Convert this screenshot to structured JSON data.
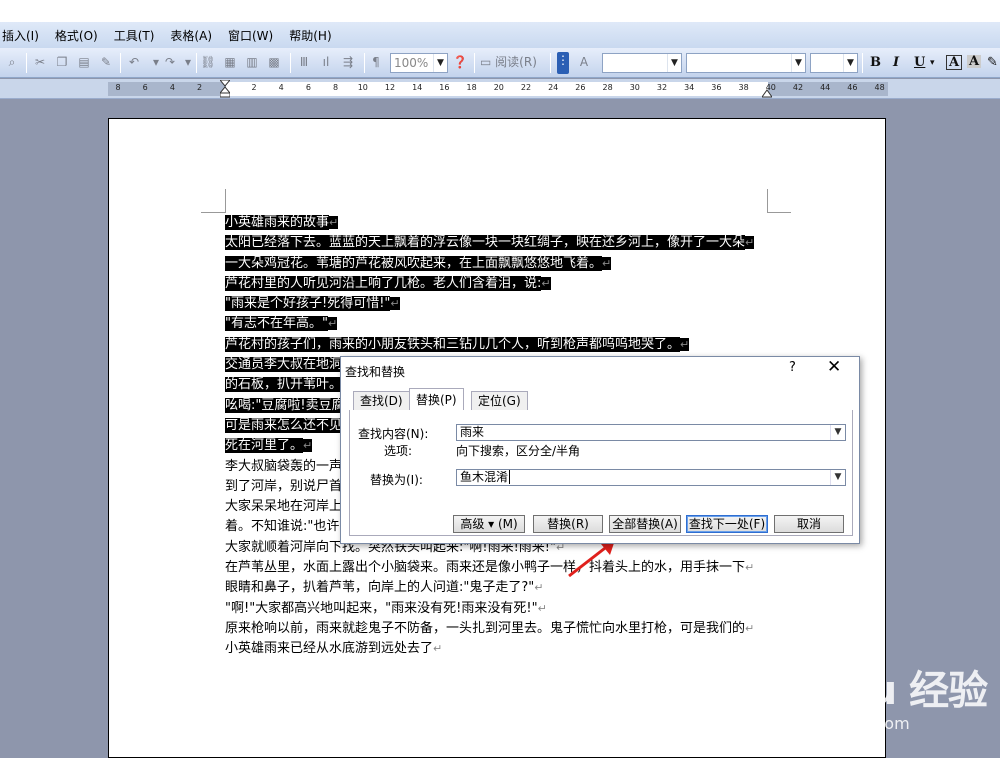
{
  "menu": [
    "插入(I)",
    "格式(O)",
    "工具(T)",
    "表格(A)",
    "窗口(W)",
    "帮助(H)"
  ],
  "toolbar": {
    "zoom_value": "100%",
    "read_label": "阅读(R)",
    "bold_label": "B",
    "italic_label": "I",
    "underline_label": "U",
    "fontcolor_label": "A",
    "highlight_label": "A"
  },
  "ruler_numbers": [
    "8",
    "6",
    "4",
    "2",
    "2",
    "4",
    "6",
    "8",
    "10",
    "12",
    "14",
    "16",
    "18",
    "20",
    "22",
    "24",
    "26",
    "28",
    "30",
    "32",
    "34",
    "36",
    "38",
    "40",
    "42",
    "44",
    "46",
    "48"
  ],
  "document": {
    "lines": [
      {
        "text": "小英雄雨来的故事",
        "selected": true
      },
      {
        "text": "太阳已经落下去。蓝蓝的天上飘着的浮云像一块一块红绸子，映在还乡河上，像开了一大朵",
        "selected": true
      },
      {
        "text": "一大朵鸡冠花。苇塘的芦花被风吹起来，在上面飘飘悠悠地飞着。",
        "selected": true
      },
      {
        "text": "芦花村里的人听见河沿上响了几枪。老人们含着泪，说:",
        "selected": true
      },
      {
        "text": "\"雨来是个好孩子!死得可惜!\"",
        "selected": true
      },
      {
        "text": "\"有志不在年高。\"",
        "selected": true
      },
      {
        "text": "芦花村的孩子们，雨来的小朋友铁头和三钻儿几个人，听到枪声都呜呜地哭了。",
        "selected": true
      },
      {
        "text": "交通员李大叔在地洞里等了好久，不见雨来回来，推开洞口上",
        "selected": true
      },
      {
        "text": "的石板，扒开苇叶。",
        "selected": true
      },
      {
        "text": "吆喝:\"豆腐啦!卖豆腐啦!\"",
        "selected": true
      },
      {
        "text": "可是雨来怎么还不见，",
        "selected": true
      },
      {
        "text": "死在河里了。",
        "selected": true
      },
      {
        "text": "李大叔脑袋轰的一声",
        "selected": false
      },
      {
        "text": "到了河岸，别说尸首",
        "selected": false
      },
      {
        "text": "大家呆呆地在河岸上",
        "selected": false
      },
      {
        "text": "着。不知谁说:\"也许",
        "selected": false
      },
      {
        "text": "大家就顺着河岸向下找。突然铁头叫起来:\"啊!雨来!雨来!\"",
        "selected": false
      },
      {
        "text": "在芦苇丛里，水面上露出个小脑袋来。雨来还是像小鸭子一样，抖着头上的水，用手抹一下",
        "selected": false
      },
      {
        "text": "眼睛和鼻子，扒着芦苇，向岸上的人问道:\"鬼子走了?\"",
        "selected": false
      },
      {
        "text": "\"啊!\"大家都高兴地叫起来，\"雨来没有死!雨来没有死!\"",
        "selected": false
      },
      {
        "text": "原来枪响以前，雨来就趁鬼子不防备，一头扎到河里去。鬼子慌忙向水里打枪，可是我们的",
        "selected": false
      },
      {
        "text": "小英雄雨来已经从水底游到远处去了",
        "selected": false
      }
    ]
  },
  "dialog": {
    "title": "查找和替换",
    "help": "?",
    "close": "✕",
    "tabs": [
      "查找(D)",
      "替换(P)",
      "定位(G)"
    ],
    "find_label": "查找内容(N):",
    "find_value": "雨来",
    "options_label": "选项:",
    "options_value": "向下搜索，区分全/半角",
    "replace_label": "替换为(I):",
    "replace_value": "鱼木混淆",
    "buttons": {
      "advanced": "高级 ▾ (M)",
      "replace": "替换(R)",
      "replace_all": "全部替换(A)",
      "find_next": "查找下一处(F)",
      "cancel": "取消"
    }
  },
  "watermark": {
    "main": "Bai  du 经验",
    "sub": "jingyan.baidu.com"
  },
  "colors": {
    "arrow": "#e0201c",
    "selection": "#000000",
    "desktop": "#8e96ac"
  }
}
